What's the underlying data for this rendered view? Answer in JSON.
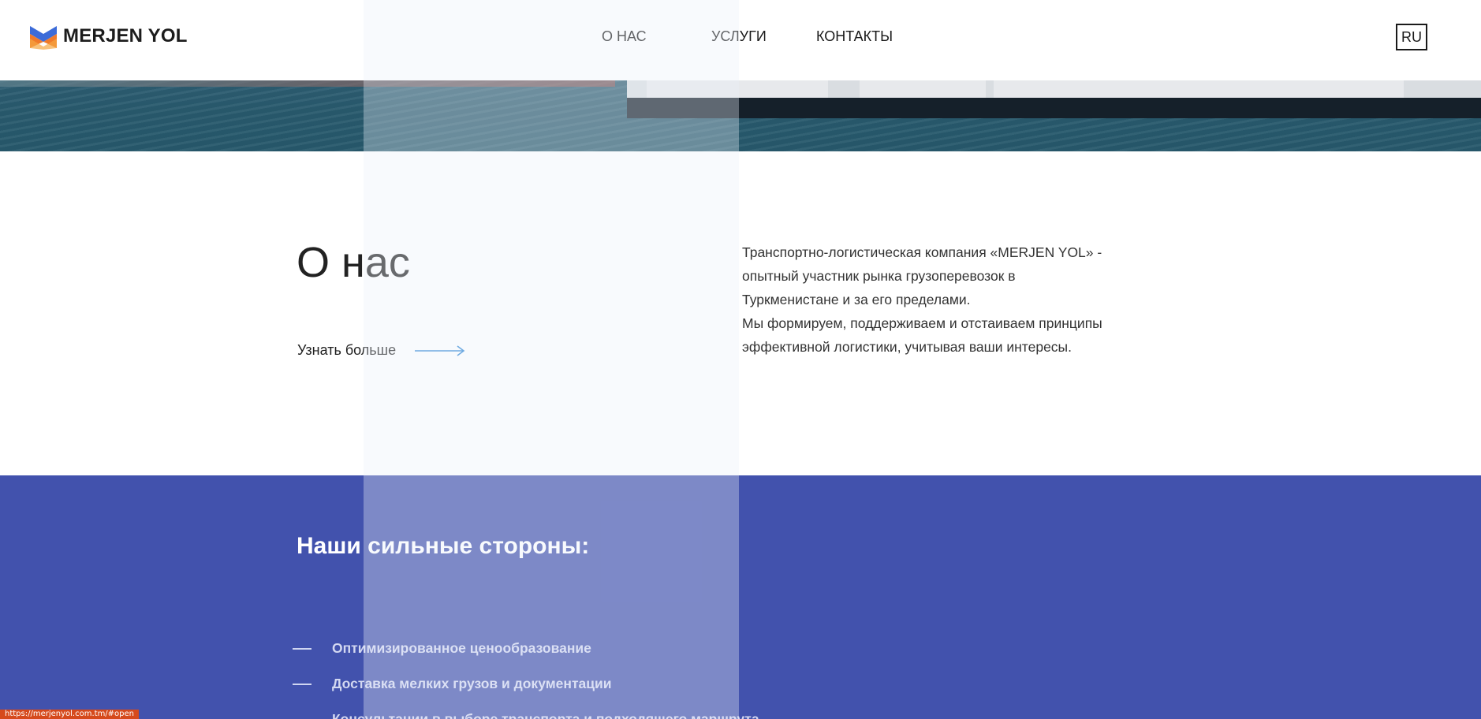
{
  "brand": {
    "name": "MERJEN YOL",
    "logo_icon": "merjen-yol-logo-icon",
    "colors": {
      "blue": "#3c6bd8",
      "orange": "#f07a2a"
    }
  },
  "nav": {
    "items": [
      {
        "label": "О НАС"
      },
      {
        "label": "УСЛУГИ"
      },
      {
        "label": "КОНТАКТЫ"
      }
    ],
    "language": "RU"
  },
  "about": {
    "title": "О нас",
    "more_label": "Узнать больше",
    "arrow_icon": "arrow-right-icon",
    "text_lines": [
      "Транспортно-логистическая компания «MERJEN YOL» -",
      "опытный участник рынка грузоперевозок в",
      "Туркменистане и за его пределами.",
      "Мы формируем, поддерживаем и отстаиваем принципы",
      "эффективной логистики, учитывая ваши интересы."
    ]
  },
  "strengths": {
    "title": "Наши сильные стороны:",
    "items": [
      "Оптимизированное ценообразование",
      "Доставка мелких грузов и документации",
      "Консультации в выборе транспорта и подходящего маршрута"
    ],
    "background_color": "#4252ad"
  },
  "status_bar": {
    "url": "https://merjenyol.com.tm/#open"
  }
}
